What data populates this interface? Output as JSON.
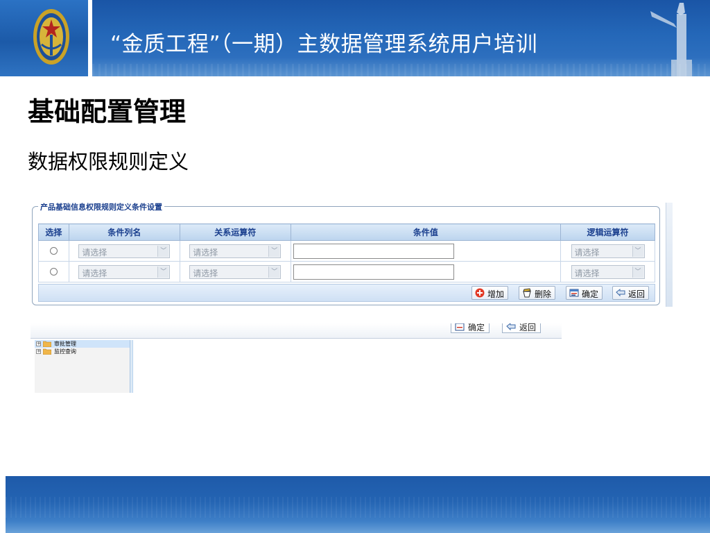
{
  "header": {
    "title": "“金质工程”（一期）主数据管理系统用户培训"
  },
  "page": {
    "title": "基础配置管理",
    "subtitle": "数据权限规则定义"
  },
  "panel": {
    "legend": "产品基础信息权限规则定义条件设置",
    "columns": [
      "选择",
      "条件列名",
      "关系运算符",
      "条件值",
      "逻辑运算符"
    ],
    "rows": [
      {
        "column_name": "请选择",
        "operator": "请选择",
        "value": "",
        "logic": "请选择"
      },
      {
        "column_name": "请选择",
        "operator": "请选择",
        "value": "",
        "logic": "请选择"
      }
    ],
    "buttons": {
      "add": "增加",
      "delete": "删除",
      "confirm": "确定",
      "back": "返回"
    }
  },
  "second_view": {
    "buttons": {
      "confirm": "确定",
      "back": "返回"
    },
    "tree": [
      "审批管理",
      "监控查询"
    ]
  },
  "icons": {
    "emblem": "national-emblem-icon",
    "column": "huabiao-column-icon",
    "add": "plus-circle-icon",
    "delete": "delete-icon",
    "confirm": "confirm-icon",
    "back": "back-arrow-icon",
    "folder": "folder-icon"
  },
  "colors": {
    "header_blue": "#1a55a6",
    "grid_header": "#1a3f8e",
    "add_icon": "#e23a26"
  }
}
